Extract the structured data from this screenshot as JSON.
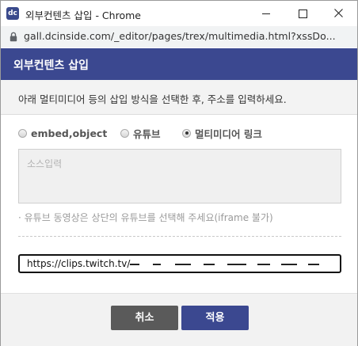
{
  "window": {
    "title": "외부컨텐츠 삽입 - Chrome",
    "app_icon_text": "dc"
  },
  "address_bar": {
    "url": "gall.dcinside.com/_editor/pages/trex/multimedia.html?xssDo..."
  },
  "dialog": {
    "title": "외부컨텐츠 삽입",
    "description": "아래 멀티미디어 등의 삽입 방식을 선택한 후, 주소를 입력하세요.",
    "options": [
      {
        "label": "embed,object",
        "selected": false
      },
      {
        "label": "유튜브",
        "selected": false
      },
      {
        "label": "멀티미디어 링크",
        "selected": true
      }
    ],
    "source_placeholder": "소스입력",
    "note": "· 유튜브 동영상은 상단의 유튜브를 선택해 주세요(iframe 불가)",
    "url_value": "https://clips.twitch.tv/",
    "buttons": {
      "cancel": "취소",
      "apply": "적용"
    }
  },
  "colors": {
    "header": "#3b4890",
    "apply_button": "#3b4890",
    "cancel_button": "#5a5a5a"
  }
}
